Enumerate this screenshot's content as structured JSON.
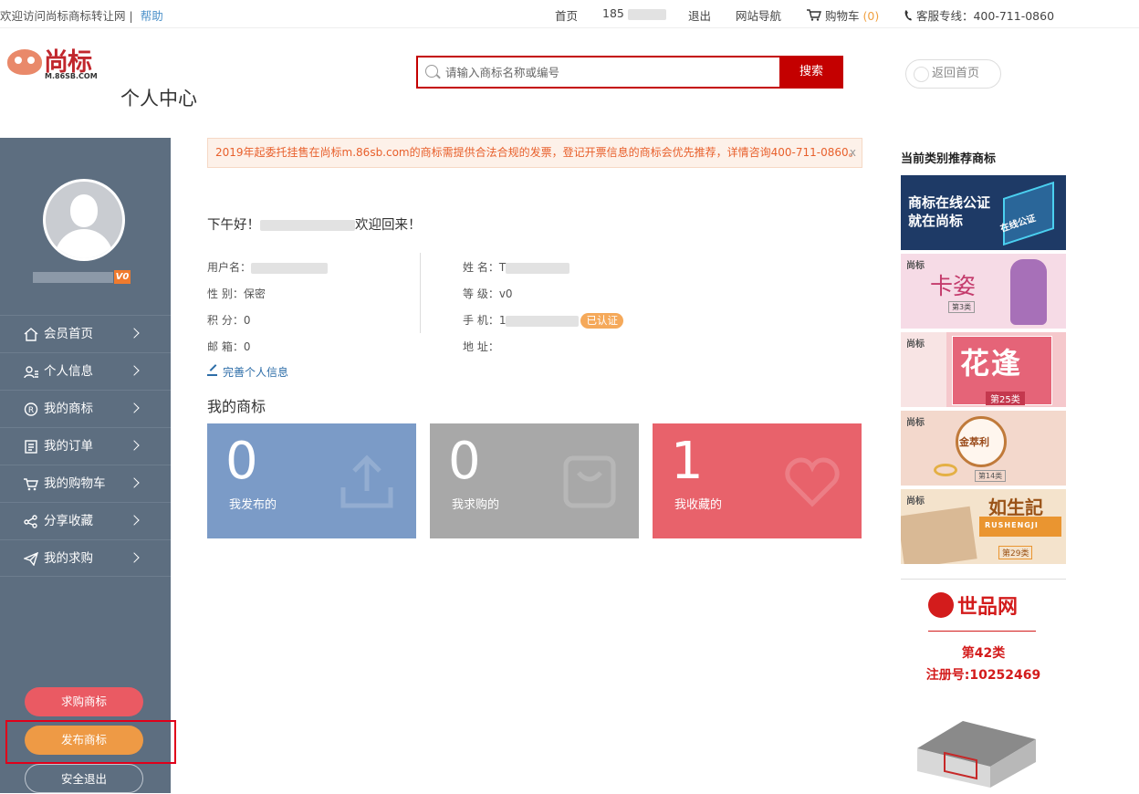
{
  "topbar": {
    "welcome": "欢迎访问尚标商标转让网 |",
    "help": "帮助",
    "home": "首页",
    "phone_prefix": "185",
    "logout": "退出",
    "site_nav": "网站导航",
    "cart": "购物车",
    "cart_count": "(0)",
    "hotline": "客服专线：400-711-0860"
  },
  "header": {
    "brand": "尚标",
    "domain": "M.86SB.COM",
    "page_title": "个人中心",
    "search_placeholder": "请输入商标名称或编号",
    "search_button": "搜索",
    "back_home": "返回首页"
  },
  "sidebar": {
    "vip_level": "V0",
    "menu": [
      {
        "label": "会员首页",
        "icon": "home-icon"
      },
      {
        "label": "个人信息",
        "icon": "user-icon"
      },
      {
        "label": "我的商标",
        "icon": "registered-icon"
      },
      {
        "label": "我的订单",
        "icon": "order-icon"
      },
      {
        "label": "我的购物车",
        "icon": "cart-icon"
      },
      {
        "label": "分享收藏",
        "icon": "share-icon"
      },
      {
        "label": "我的求购",
        "icon": "send-icon"
      }
    ],
    "buy_button": "求购商标",
    "publish_button": "发布商标",
    "logout_button": "安全退出"
  },
  "main": {
    "notice": "2019年起委托挂售在尚标m.86sb.com的商标需提供合法合规的发票，登记开票信息的商标会优先推荐，详情咨询400-711-0860。",
    "notice_close": "x",
    "greeting_prefix": "下午好！",
    "greeting_suffix": "欢迎回来！",
    "info": {
      "username_label": "用户名：",
      "gender": "性 别：保密",
      "points": "积 分：0",
      "email": "邮 箱：0",
      "name_label": "姓 名：",
      "name_initial": "T",
      "level": "等 级：v0",
      "mobile_label": "手 机：",
      "mobile_initial": "1",
      "verified": "已认证",
      "address": "地 址："
    },
    "complete_profile": "完善个人信息",
    "section_title": "我的商标",
    "cards": [
      {
        "count": "0",
        "label": "我发布的",
        "color": "#7b9bc7"
      },
      {
        "count": "0",
        "label": "我求购的",
        "color": "#a8a8a8"
      },
      {
        "count": "1",
        "label": "我收藏的",
        "color": "#e8626b"
      }
    ]
  },
  "right": {
    "title": "当前类别推荐商标",
    "ad1_line1": "商标在线公证",
    "ad1_line2": "就在尚标",
    "ad1_chip": "在线公证",
    "ad_tag": "尚标",
    "ad2_name": "卡姿",
    "ad2_class": "第3类",
    "ad3_name": "花逢",
    "ad3_class": "第25类",
    "ad4_name": "金萃利",
    "ad4_class": "第14类",
    "ad5_name": "如生記",
    "ad5_sub": "RUSHENGJI",
    "ad5_class": "第29类",
    "ad6_brand": "世品网",
    "ad6_class": "第42类",
    "ad6_reg": "注册号:10252469"
  }
}
